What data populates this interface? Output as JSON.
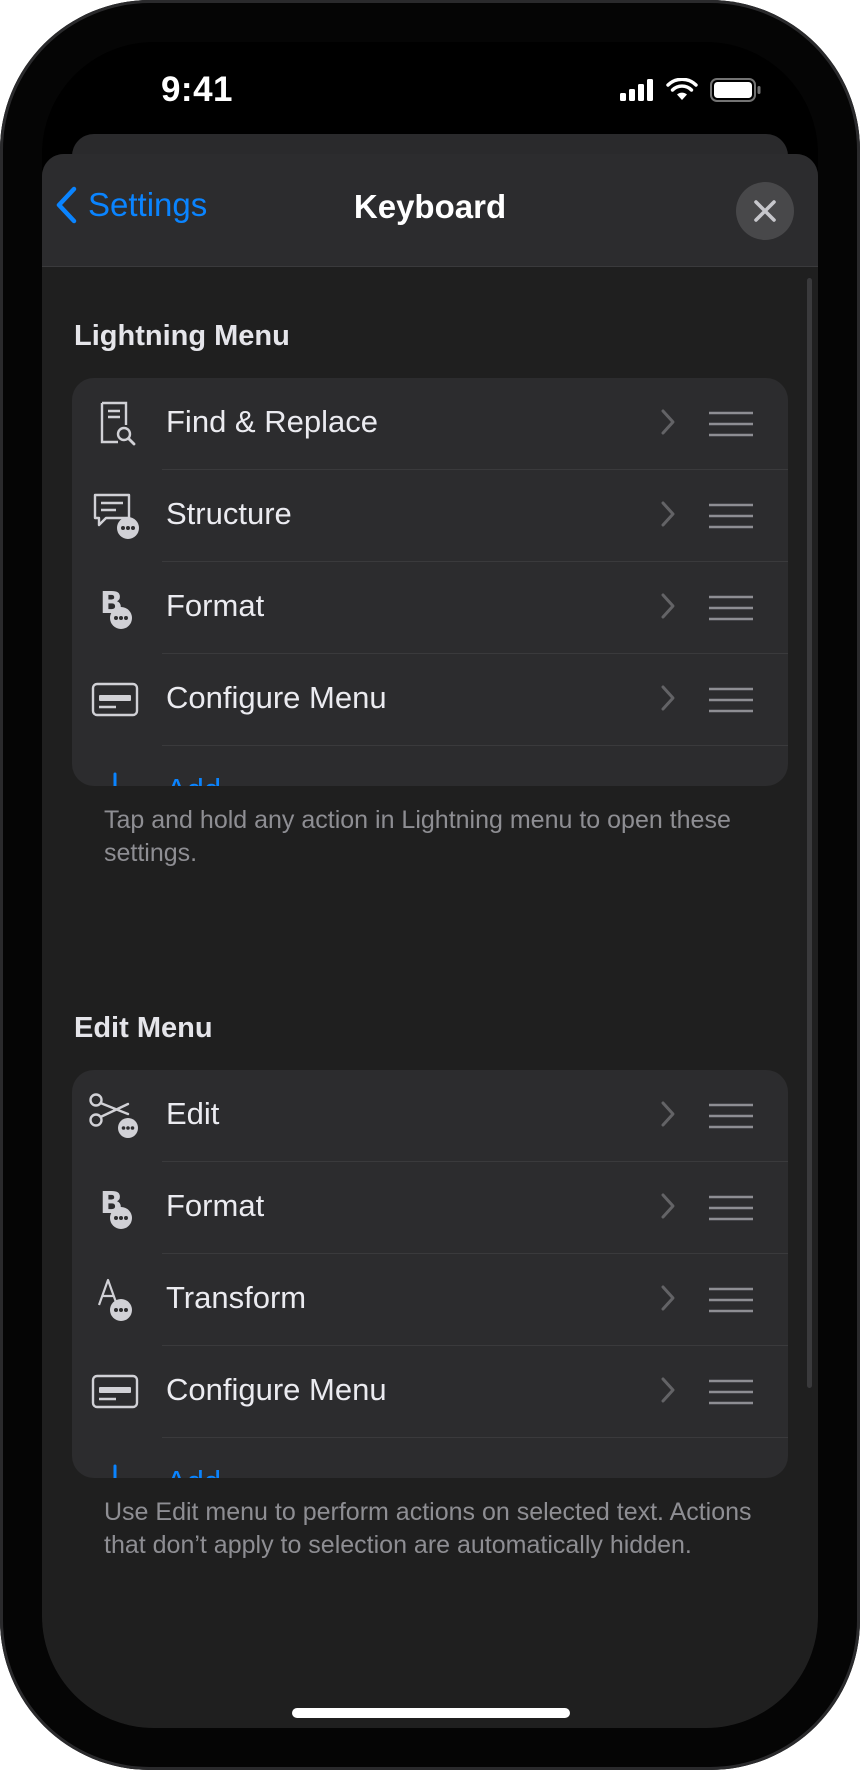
{
  "status_bar": {
    "time": "9:41"
  },
  "nav": {
    "back_label": "Settings",
    "title": "Keyboard"
  },
  "lightning_menu": {
    "header": "Lightning Menu",
    "items": [
      {
        "label": "Find & Replace",
        "icon": "find-replace-icon"
      },
      {
        "label": "Structure",
        "icon": "structure-icon"
      },
      {
        "label": "Format",
        "icon": "format-icon"
      },
      {
        "label": "Configure Menu",
        "icon": "configure-menu-icon"
      }
    ],
    "add_label": "Add...",
    "footnote": "Tap and hold any action in Lightning menu to open these settings."
  },
  "edit_menu": {
    "header": "Edit Menu",
    "items": [
      {
        "label": "Edit",
        "icon": "scissors-icon"
      },
      {
        "label": "Format",
        "icon": "format-icon"
      },
      {
        "label": "Transform",
        "icon": "transform-icon"
      },
      {
        "label": "Configure Menu",
        "icon": "configure-menu-icon"
      }
    ],
    "add_label": "Add...",
    "footnote": "Use Edit menu to perform actions on selected text. Actions that don’t apply to selection are automatically hidden."
  },
  "colors": {
    "accent": "#0a84ff",
    "background": "#1f1f1f",
    "cell": "#2c2c2e"
  }
}
